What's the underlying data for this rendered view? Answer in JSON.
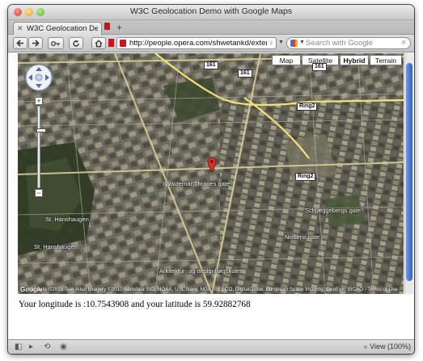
{
  "window": {
    "title": "W3C Geolocation Demo with Google Maps"
  },
  "tabs": [
    {
      "label": "W3C Geolocation De..."
    }
  ],
  "toolbar": {
    "back_icon": "back-arrow-icon",
    "forward_icon": "forward-arrow-icon",
    "wand_icon": "key-icon",
    "reload_icon": "reload-icon",
    "home_icon": "home-icon",
    "url": "http://people.opera.com/shwetankd/externa",
    "search_placeholder": "Search with Google"
  },
  "map": {
    "types": [
      "Map",
      "Satellite",
      "Hybrid",
      "Terrain"
    ],
    "selected_type": "Hybrid",
    "road_labels": [
      "161",
      "161",
      "161",
      "Ring2",
      "Ring2"
    ],
    "place_labels": [
      "Waldemar Thranes gate",
      "St. Hanshaugen",
      "St. Hanshaugen",
      "Schlæggebergs gate",
      "Nissens gate",
      "Arkitektur- og designhøgskolen"
    ],
    "attribution": "Kartdata ©2010 Tele Atlas Imagery ©2010 Aerodata SIO, NOAA, U.S. Navy, NGA, GEBCO, DigitalGlobe, European Space Imaging, GeoEye, IBCAO",
    "terms_link": "Terms of Use",
    "logo": "Google"
  },
  "result": {
    "text": "Your longitude is :10.7543908 and your latitude is 59.92882768"
  },
  "statusbar": {
    "zoom_label": "View (100%)"
  },
  "colors": {
    "marker": "#d6312a",
    "scroll_thumb": "#2f62c4"
  }
}
